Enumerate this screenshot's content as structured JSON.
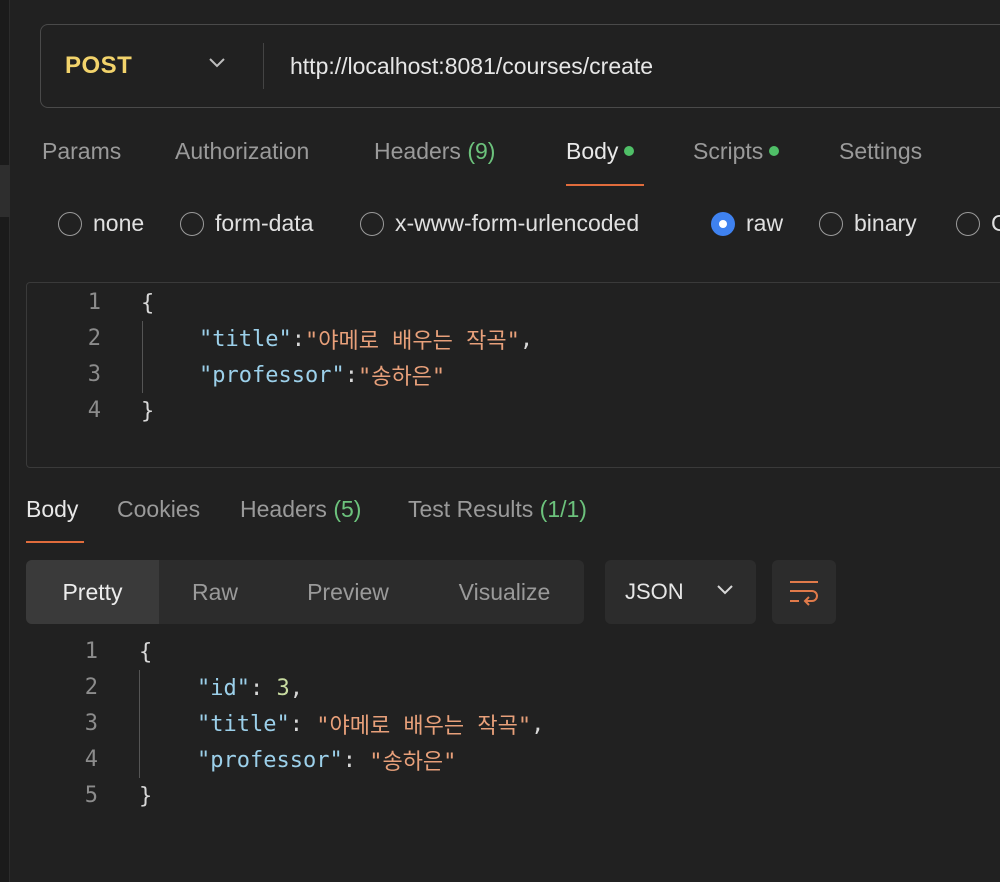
{
  "request": {
    "method": "POST",
    "url": "http://localhost:8081/courses/create"
  },
  "request_tabs": [
    {
      "label": "Params"
    },
    {
      "label": "Authorization"
    },
    {
      "label": "Headers",
      "count": "(9)"
    },
    {
      "label": "Body",
      "active": true,
      "dot": true
    },
    {
      "label": "Scripts",
      "dot": true
    },
    {
      "label": "Settings"
    }
  ],
  "body_types": [
    {
      "label": "none",
      "selected": false
    },
    {
      "label": "form-data",
      "selected": false
    },
    {
      "label": "x-www-form-urlencoded",
      "selected": false
    },
    {
      "label": "raw",
      "selected": true
    },
    {
      "label": "binary",
      "selected": false
    },
    {
      "label": "G",
      "selected": false
    }
  ],
  "request_body": {
    "line_numbers": [
      "1",
      "2",
      "3",
      "4"
    ],
    "open_brace": "{",
    "close_brace": "}",
    "title_key": "\"title\"",
    "title_value": "\"야메로 배우는 작곡\"",
    "professor_key": "\"professor\"",
    "professor_value": "\"송하은\"",
    "colon": ":",
    "comma": ","
  },
  "response_tabs": [
    {
      "label": "Body",
      "active": true
    },
    {
      "label": "Cookies"
    },
    {
      "label": "Headers",
      "count": "(5)"
    },
    {
      "label": "Test Results",
      "count": "(1/1)"
    }
  ],
  "view_modes": [
    {
      "label": "Pretty",
      "active": true
    },
    {
      "label": "Raw"
    },
    {
      "label": "Preview"
    },
    {
      "label": "Visualize"
    }
  ],
  "format": "JSON",
  "response_body": {
    "line_numbers": [
      "1",
      "2",
      "3",
      "4",
      "5"
    ],
    "open_brace": "{",
    "close_brace": "}",
    "id_key": "\"id\"",
    "id_value": "3",
    "title_key": "\"title\"",
    "title_value": "\"야메로 배우는 작곡\"",
    "professor_key": "\"professor\"",
    "professor_value": "\"송하은\"",
    "colon": ": ",
    "comma": ","
  },
  "colors": {
    "method": "#f2d36b",
    "accent_underline": "#e06c3c",
    "status_dot": "#4fbf67",
    "radio_selected": "#3f82f0",
    "json_key": "#9cd0ea",
    "json_string": "#e8a07a",
    "json_number": "#c8dba0"
  },
  "icons": {
    "method_dropdown": "chevron-down-icon",
    "format_dropdown": "chevron-down-icon",
    "wrap": "text-wrap-icon"
  }
}
